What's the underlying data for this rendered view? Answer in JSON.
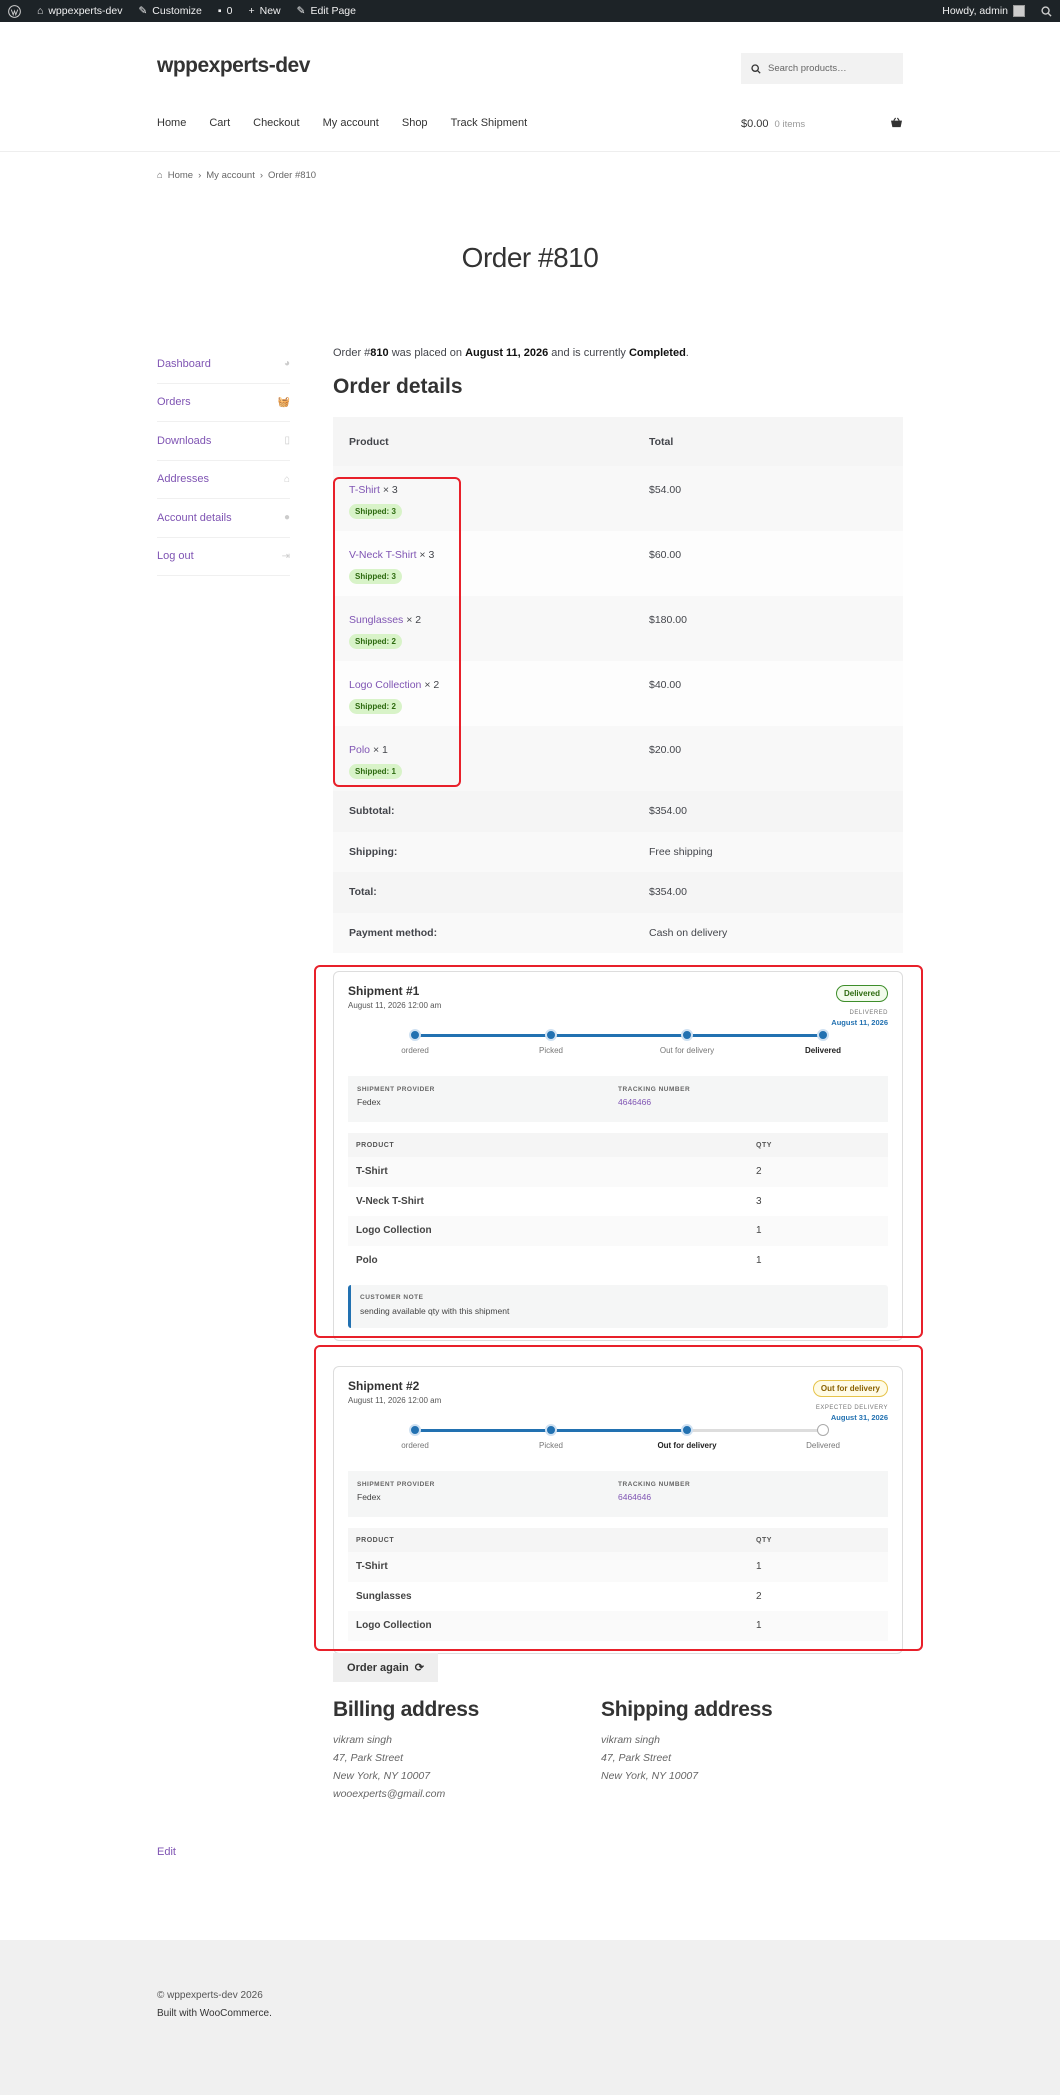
{
  "adminbar": {
    "site": "wppexperts-dev",
    "customize": "Customize",
    "comments": "0",
    "new": "New",
    "edit_page": "Edit Page",
    "howdy": "Howdy, admin"
  },
  "header": {
    "site_title": "wppexperts-dev",
    "search_placeholder": "Search products…",
    "nav": [
      "Home",
      "Cart",
      "Checkout",
      "My account",
      "Shop",
      "Track Shipment"
    ],
    "cart_total": "$0.00",
    "cart_items": "0 items"
  },
  "breadcrumb": {
    "home": "Home",
    "account": "My account",
    "current": "Order #810"
  },
  "page_title": "Order #810",
  "sidebar": [
    {
      "label": "Dashboard",
      "icon": "dashboard-icon"
    },
    {
      "label": "Orders",
      "icon": "basket-icon"
    },
    {
      "label": "Downloads",
      "icon": "file-icon"
    },
    {
      "label": "Addresses",
      "icon": "home-icon"
    },
    {
      "label": "Account details",
      "icon": "user-icon"
    },
    {
      "label": "Log out",
      "icon": "logout-icon"
    }
  ],
  "summary": {
    "p1": "Order #",
    "num": "810",
    "p2": " was placed on ",
    "date": "August 11, 2026",
    "p3": " and is currently ",
    "status": "Completed",
    "p4": "."
  },
  "order_details": {
    "title": "Order details",
    "col_product": "Product",
    "col_total": "Total",
    "items": [
      {
        "name": "T-Shirt",
        "qty": "× 3",
        "shipped": "Shipped: 3",
        "total": "$54.00"
      },
      {
        "name": "V-Neck T-Shirt",
        "qty": "× 3",
        "shipped": "Shipped: 3",
        "total": "$60.00"
      },
      {
        "name": "Sunglasses",
        "qty": "× 2",
        "shipped": "Shipped: 2",
        "total": "$180.00"
      },
      {
        "name": "Logo Collection",
        "qty": "× 2",
        "shipped": "Shipped: 2",
        "total": "$40.00"
      },
      {
        "name": "Polo",
        "qty": "× 1",
        "shipped": "Shipped: 1",
        "total": "$20.00"
      }
    ],
    "totals": [
      {
        "label": "Subtotal:",
        "value": "$354.00"
      },
      {
        "label": "Shipping:",
        "value": "Free shipping"
      },
      {
        "label": "Total:",
        "value": "$354.00"
      },
      {
        "label": "Payment method:",
        "value": "Cash on delivery"
      }
    ]
  },
  "shipments": [
    {
      "title": "Shipment #1",
      "date": "August 11, 2026 12:00 am",
      "status": "Delivered",
      "delivery_label": "DELIVERED",
      "delivery_date": "August 11, 2026",
      "steps": [
        "ordered",
        "Picked",
        "Out for delivery",
        "Delivered"
      ],
      "progress": 4,
      "provider_label": "SHIPMENT PROVIDER",
      "provider": "Fedex",
      "tracking_label": "TRACKING NUMBER",
      "tracking": "4646466",
      "col_product": "PRODUCT",
      "col_qty": "QTY",
      "items": [
        {
          "name": "T-Shirt",
          "qty": "2"
        },
        {
          "name": "V-Neck T-Shirt",
          "qty": "3"
        },
        {
          "name": "Logo Collection",
          "qty": "1"
        },
        {
          "name": "Polo",
          "qty": "1"
        }
      ],
      "note_label": "CUSTOMER NOTE",
      "note": "sending available qty with this shipment"
    },
    {
      "title": "Shipment #2",
      "date": "August 11, 2026 12:00 am",
      "status": "Out for delivery",
      "delivery_label": "EXPECTED DELIVERY",
      "delivery_date": "August 31, 2026",
      "steps": [
        "ordered",
        "Picked",
        "Out for delivery",
        "Delivered"
      ],
      "progress": 3,
      "provider_label": "SHIPMENT PROVIDER",
      "provider": "Fedex",
      "tracking_label": "TRACKING NUMBER",
      "tracking": "6464646",
      "col_product": "PRODUCT",
      "col_qty": "QTY",
      "items": [
        {
          "name": "T-Shirt",
          "qty": "1"
        },
        {
          "name": "Sunglasses",
          "qty": "2"
        },
        {
          "name": "Logo Collection",
          "qty": "1"
        }
      ]
    }
  ],
  "order_again": "Order again",
  "billing": {
    "title": "Billing address",
    "lines": [
      "vikram singh",
      "47, Park Street",
      "New York, NY 10007",
      "wooexperts@gmail.com"
    ]
  },
  "shipping": {
    "title": "Shipping address",
    "lines": [
      "vikram singh",
      "47, Park Street",
      "New York, NY 10007"
    ]
  },
  "edit": "Edit",
  "footer": {
    "copyright": "© wppexperts-dev 2026",
    "built": "Built with WooCommerce",
    "built_suffix": "."
  },
  "colors": {
    "accent": "#7f54b3",
    "blue": "#2271b1",
    "highlight": "#e8202a"
  }
}
